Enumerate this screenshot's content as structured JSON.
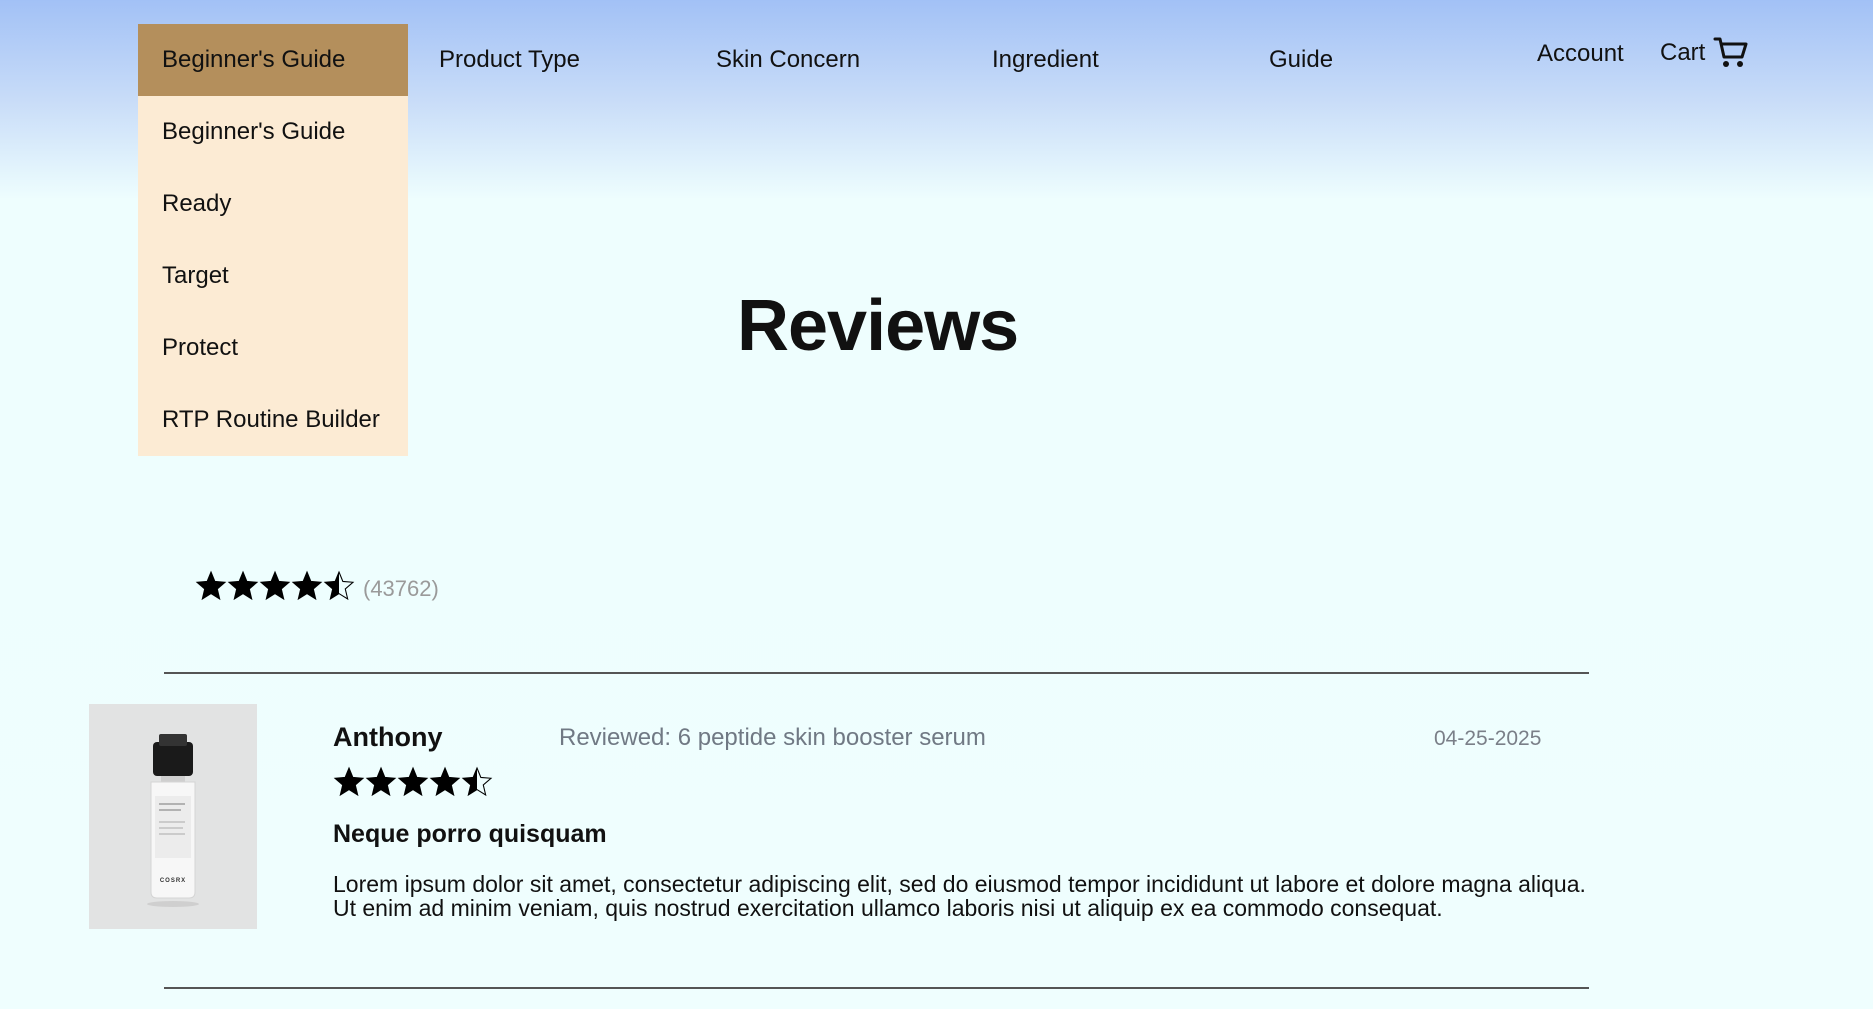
{
  "nav": {
    "items": [
      "Product Type",
      "Skin Concern",
      "Ingredient",
      "Guide"
    ],
    "account": "Account",
    "cart": "Cart"
  },
  "dropdown": {
    "active": "Beginner's Guide",
    "items": [
      "Beginner's Guide",
      "Ready",
      "Target",
      "Protect",
      "RTP Routine Builder"
    ]
  },
  "page": {
    "title": "Reviews"
  },
  "summary": {
    "rating": 4.5,
    "max_rating": 5,
    "count": "(43762)"
  },
  "review": {
    "name": "Anthony",
    "product": "Reviewed: 6 peptide skin booster serum",
    "date": "04-25-2025",
    "rating": 4.5,
    "title": "Neque porro quisquam",
    "body": "Lorem ipsum dolor sit amet, consectetur adipiscing elit, sed do eiusmod tempor incididunt ut labore et dolore magna aliqua. Ut enim ad minim veniam, quis nostrud exercitation ullamco laboris nisi ut aliquip ex ea commodo consequat.",
    "image_brand": "COSRX"
  },
  "icons": {
    "cart": "cart-icon",
    "star": "star-icon"
  },
  "colors": {
    "dropdown_active": "#b48f5c",
    "dropdown_bg": "#fcebd4",
    "header_top": "#a2c1f6",
    "page_bg": "#effefe"
  }
}
